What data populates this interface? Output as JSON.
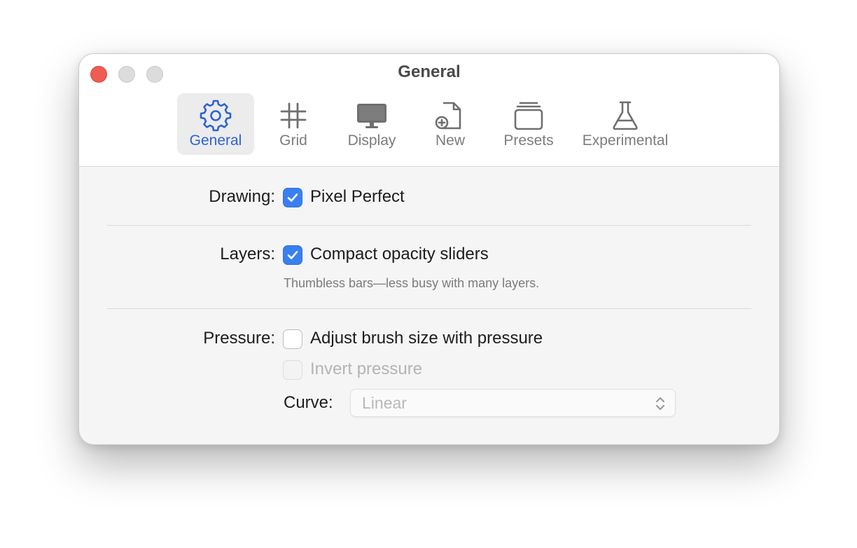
{
  "window": {
    "title": "General"
  },
  "toolbar": {
    "tabs": [
      {
        "label": "General",
        "icon": "gear-icon",
        "selected": true
      },
      {
        "label": "Grid",
        "icon": "grid-icon",
        "selected": false
      },
      {
        "label": "Display",
        "icon": "display-icon",
        "selected": false
      },
      {
        "label": "New",
        "icon": "new-document-icon",
        "selected": false
      },
      {
        "label": "Presets",
        "icon": "presets-icon",
        "selected": false
      },
      {
        "label": "Experimental",
        "icon": "flask-icon",
        "selected": false
      }
    ]
  },
  "settings": {
    "drawing": {
      "label": "Drawing:",
      "pixel_perfect": {
        "label": "Pixel Perfect",
        "checked": true
      }
    },
    "layers": {
      "label": "Layers:",
      "compact_sliders": {
        "label": "Compact opacity sliders",
        "checked": true
      },
      "helper": "Thumbless bars—less busy with many layers."
    },
    "pressure": {
      "label": "Pressure:",
      "adjust_brush": {
        "label": "Adjust brush size with pressure",
        "checked": false
      },
      "invert": {
        "label": "Invert pressure",
        "checked": false,
        "disabled": true
      },
      "curve": {
        "label": "Curve:",
        "value": "Linear",
        "disabled": true
      }
    }
  },
  "colors": {
    "accent": "#3a7ff1",
    "selected_tab_text": "#2e62d6",
    "close_button": "#ee5c53"
  }
}
